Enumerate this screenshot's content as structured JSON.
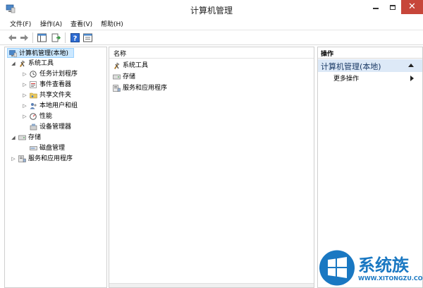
{
  "window": {
    "title": "计算机管理",
    "close_glyph": "✕"
  },
  "menu": [
    {
      "label": "文件(F)"
    },
    {
      "label": "操作(A)"
    },
    {
      "label": "查看(V)"
    },
    {
      "label": "帮助(H)"
    }
  ],
  "toolbar": {
    "buttons": [
      "back-arrow-icon",
      "forward-arrow-icon",
      "show-hide-tree-icon",
      "export-list-icon",
      "help-icon",
      "properties-icon"
    ],
    "help_glyph": "?"
  },
  "tree": {
    "root": "计算机管理(本地)",
    "system_tools": "系统工具",
    "task_scheduler": "任务计划程序",
    "event_viewer": "事件查看器",
    "shared_folders": "共享文件夹",
    "local_users": "本地用户和组",
    "performance": "性能",
    "device_manager": "设备管理器",
    "storage": "存储",
    "disk_management": "磁盘管理",
    "services_apps": "服务和应用程序",
    "expander_collapsed": "▷",
    "expander_expanded": "◢"
  },
  "list": {
    "column_name": "名称",
    "items": [
      "系统工具",
      "存储",
      "服务和应用程序"
    ]
  },
  "actions": {
    "header": "操作",
    "section_title": "计算机管理(本地)",
    "more_actions": "更多操作"
  },
  "watermark": {
    "text": "系统族",
    "sub": "WWW.XITONGZU.COM"
  },
  "colors": {
    "close_button": "#c7463a",
    "selection": "#cce8ff",
    "actions_section": "#dde9f7",
    "watermark_blue": "#1a78c2"
  }
}
